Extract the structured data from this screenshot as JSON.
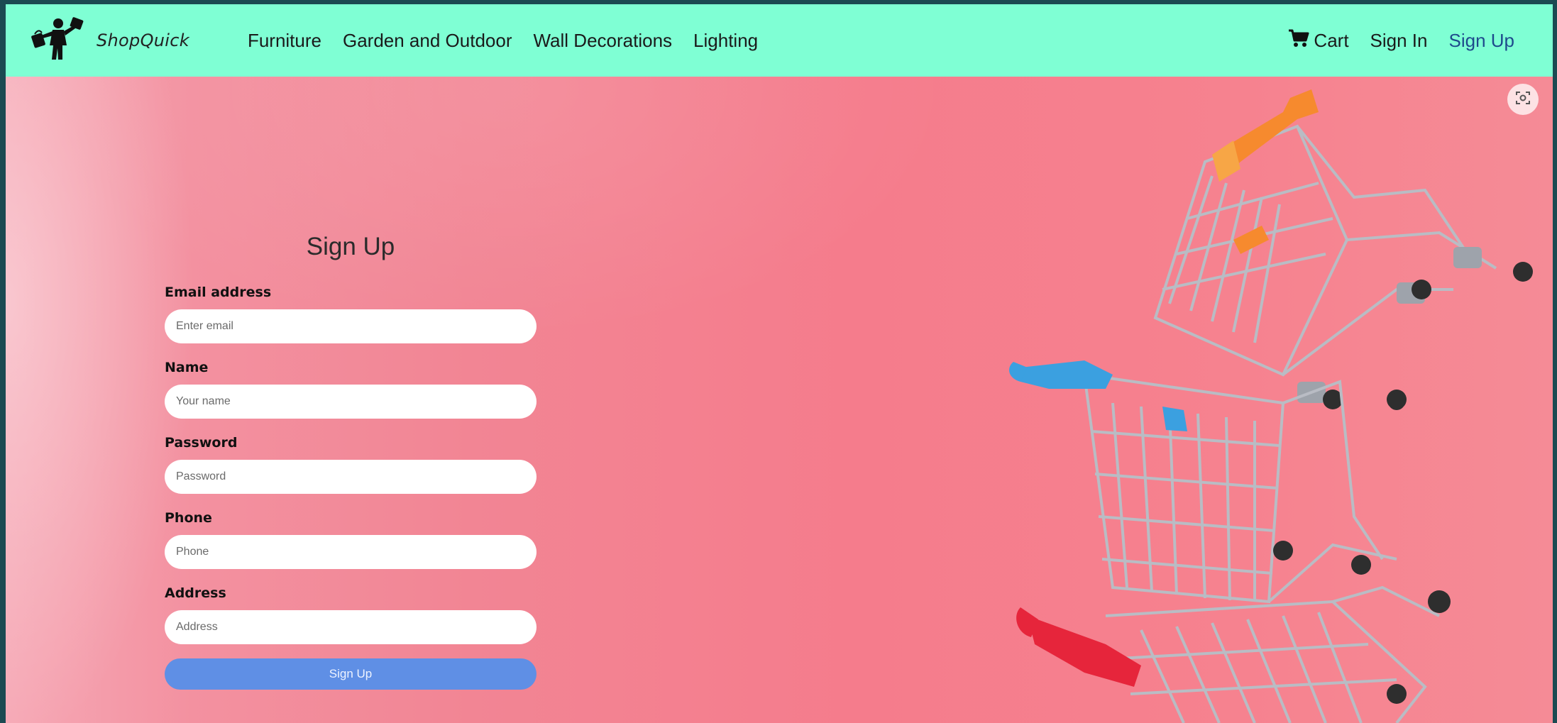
{
  "brand": {
    "name": "ShopQuick",
    "logo_icon": "shopper-with-bags-icon"
  },
  "nav": {
    "links": [
      "Furniture",
      "Garden and Outdoor",
      "Wall Decorations",
      "Lighting"
    ],
    "cart_label": "Cart",
    "cart_icon": "cart-icon",
    "sign_in": "Sign In",
    "sign_up": "Sign Up"
  },
  "form": {
    "title": "Sign Up",
    "fields": [
      {
        "label": "Email address",
        "placeholder": "Enter email"
      },
      {
        "label": "Name",
        "placeholder": "Your name"
      },
      {
        "label": "Password",
        "placeholder": "Password"
      },
      {
        "label": "Phone",
        "placeholder": "Phone"
      },
      {
        "label": "Address",
        "placeholder": "Address"
      }
    ],
    "submit_label": "Sign Up"
  },
  "colors": {
    "navbar": "#7fffd4",
    "background": "#f57c8c",
    "button": "#5f8fe5",
    "sign_up_link": "#1e4a8c"
  }
}
